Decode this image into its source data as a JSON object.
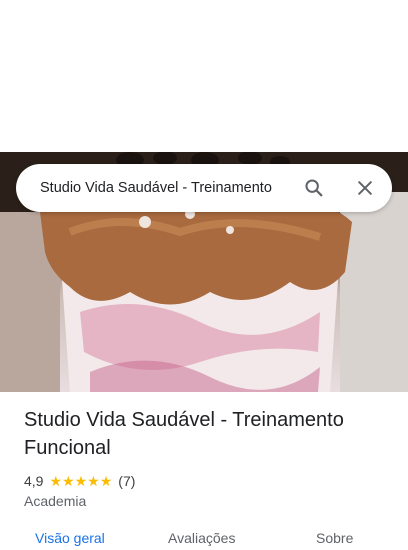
{
  "search": {
    "query": "Studio Vida Saudável - Treinamento",
    "search_icon": "search-icon",
    "close_icon": "close-icon"
  },
  "place": {
    "title": "Studio Vida Saudável - Treinamento Funcional",
    "rating": "4,9",
    "rating_value": 4.9,
    "stars_max": 5,
    "review_count": "(7)",
    "category": "Academia"
  },
  "tabs": [
    {
      "label": "Visão geral",
      "active": true
    },
    {
      "label": "Avaliações",
      "active": false
    },
    {
      "label": "Sobre",
      "active": false
    }
  ],
  "colors": {
    "accent": "#1a73e8",
    "star": "#fbbc04"
  }
}
